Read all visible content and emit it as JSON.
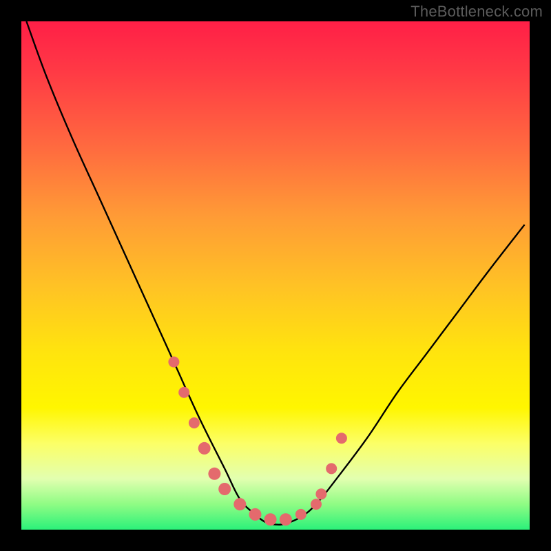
{
  "watermark": "TheBottleneck.com",
  "colors": {
    "frame": "#000000",
    "watermark": "#5b5b5b",
    "curve": "#000000",
    "dots": "#e46a6d",
    "gradient_top": "#ff1f47",
    "gradient_bottom": "#2bf17a"
  },
  "chart_data": {
    "type": "line",
    "title": "",
    "xlabel": "",
    "ylabel": "",
    "xlim": [
      0,
      100
    ],
    "ylim": [
      0,
      100
    ],
    "series": [
      {
        "name": "bottleneck-curve",
        "x": [
          1,
          5,
          10,
          15,
          20,
          25,
          30,
          35,
          40,
          43,
          46,
          48,
          50,
          52,
          55,
          58,
          62,
          68,
          74,
          80,
          86,
          92,
          99
        ],
        "values": [
          100,
          89,
          77,
          66,
          55,
          44,
          33,
          22,
          12,
          6,
          3,
          1.5,
          1,
          1.2,
          2.5,
          5,
          10,
          18,
          27,
          35,
          43,
          51,
          60
        ]
      }
    ],
    "scatter": {
      "name": "marker-dots",
      "x": [
        30,
        32,
        34,
        36,
        38,
        40,
        43,
        46,
        49,
        52,
        55,
        58,
        59,
        61,
        63
      ],
      "values": [
        33,
        27,
        21,
        16,
        11,
        8,
        5,
        3,
        2,
        2,
        3,
        5,
        7,
        12,
        18
      ]
    }
  }
}
